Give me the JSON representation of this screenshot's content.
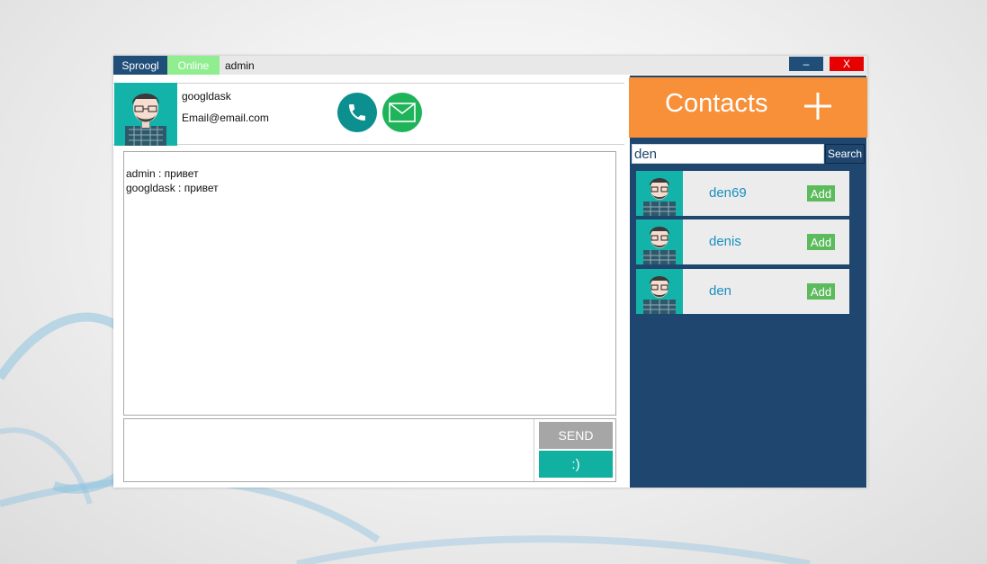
{
  "titlebar": {
    "app_name": "Sproogl",
    "status": "Online",
    "username": "admin",
    "minimize_label": "–",
    "close_label": "X"
  },
  "profile": {
    "name": "googldask",
    "email": "Email@email.com",
    "call_icon": "phone-icon",
    "mail_icon": "envelope-icon"
  },
  "chat": {
    "messages": [
      "admin : привет",
      "googldask : привет"
    ]
  },
  "compose": {
    "value": "",
    "send_label": "SEND",
    "emoji_label": ":)"
  },
  "contacts": {
    "title": "Contacts",
    "add_icon": "plus-icon",
    "search_value": "den",
    "search_label": "Search",
    "results": [
      {
        "name": "den69",
        "add_label": "Add"
      },
      {
        "name": "denis",
        "add_label": "Add"
      },
      {
        "name": "den",
        "add_label": "Add"
      }
    ]
  },
  "colors": {
    "navy": "#1f466e",
    "orange": "#f79039",
    "online": "#90ee90",
    "close_red": "#e60000",
    "teal": "#12b0a0",
    "link_blue": "#1a8fc0"
  }
}
